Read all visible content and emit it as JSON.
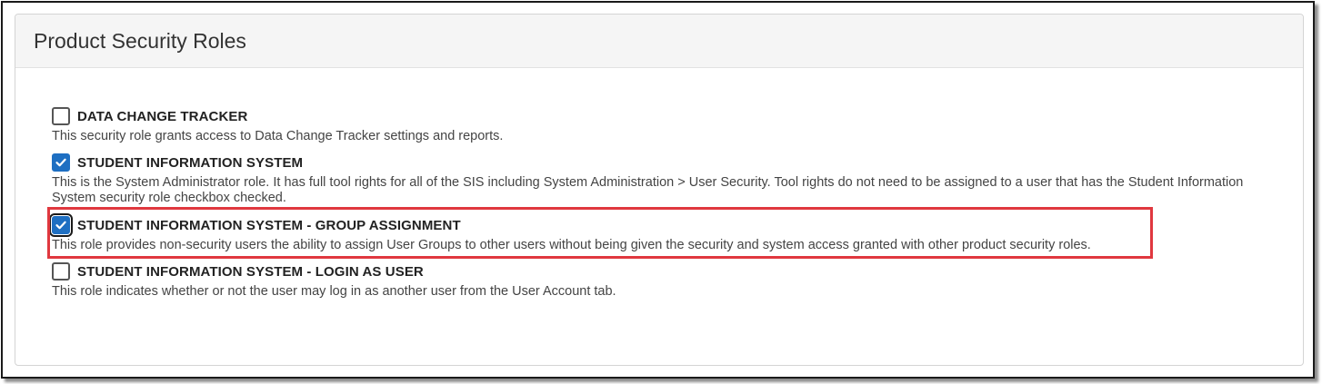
{
  "panel": {
    "title": "Product Security Roles"
  },
  "roles": [
    {
      "label": "DATA CHANGE TRACKER",
      "description": "This security role grants access to Data Change Tracker settings and reports.",
      "checked": false
    },
    {
      "label": "STUDENT INFORMATION SYSTEM",
      "description": "This is the System Administrator role. It has full tool rights for all of the SIS including System Administration > User Security. Tool rights do not need to be assigned to a user that has the Student Information System security role checkbox checked.",
      "checked": true
    },
    {
      "label": "STUDENT INFORMATION SYSTEM - GROUP ASSIGNMENT",
      "description": "This role provides non-security users the ability to assign User Groups to other users without being given the security and system access granted with other product security roles.",
      "checked": true
    },
    {
      "label": "STUDENT INFORMATION SYSTEM - LOGIN AS USER",
      "description": "This role indicates whether or not the user may log in as another user from the User Account tab.",
      "checked": false
    }
  ],
  "colors": {
    "checkbox_checked": "#1e6fc2",
    "highlight_border": "#e0383f",
    "header_bg": "#f5f5f5"
  },
  "icons": {
    "checked": "checkmark-icon"
  }
}
